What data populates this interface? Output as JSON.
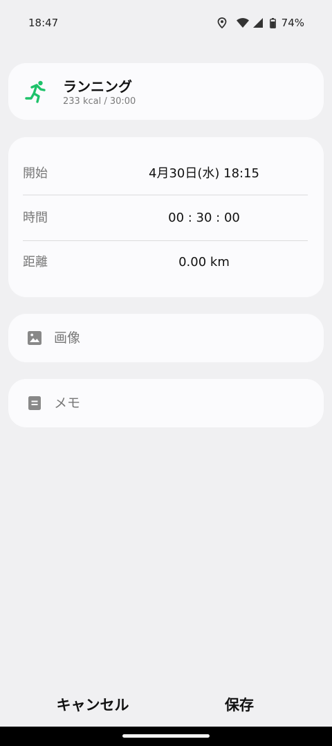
{
  "status_bar": {
    "time": "18:47",
    "battery_percent": "74%",
    "icons": [
      "location-icon",
      "wifi-icon",
      "cell-signal-icon",
      "battery-icon"
    ]
  },
  "activity": {
    "icon": "running-icon",
    "title": "ランニング",
    "subtitle": "233 kcal / 30:00",
    "accent_color": "#1ec26a"
  },
  "details": {
    "start_label": "開始",
    "start_value": "4月30日(水) 18:15",
    "duration_label": "時間",
    "duration_value": "00 : 30 : 00",
    "distance_label": "距離",
    "distance_value": "0.00 km"
  },
  "image_row": {
    "icon": "image-icon",
    "label": "画像"
  },
  "memo_row": {
    "icon": "memo-icon",
    "label": "メモ"
  },
  "actions": {
    "cancel_label": "キャンセル",
    "save_label": "保存"
  }
}
